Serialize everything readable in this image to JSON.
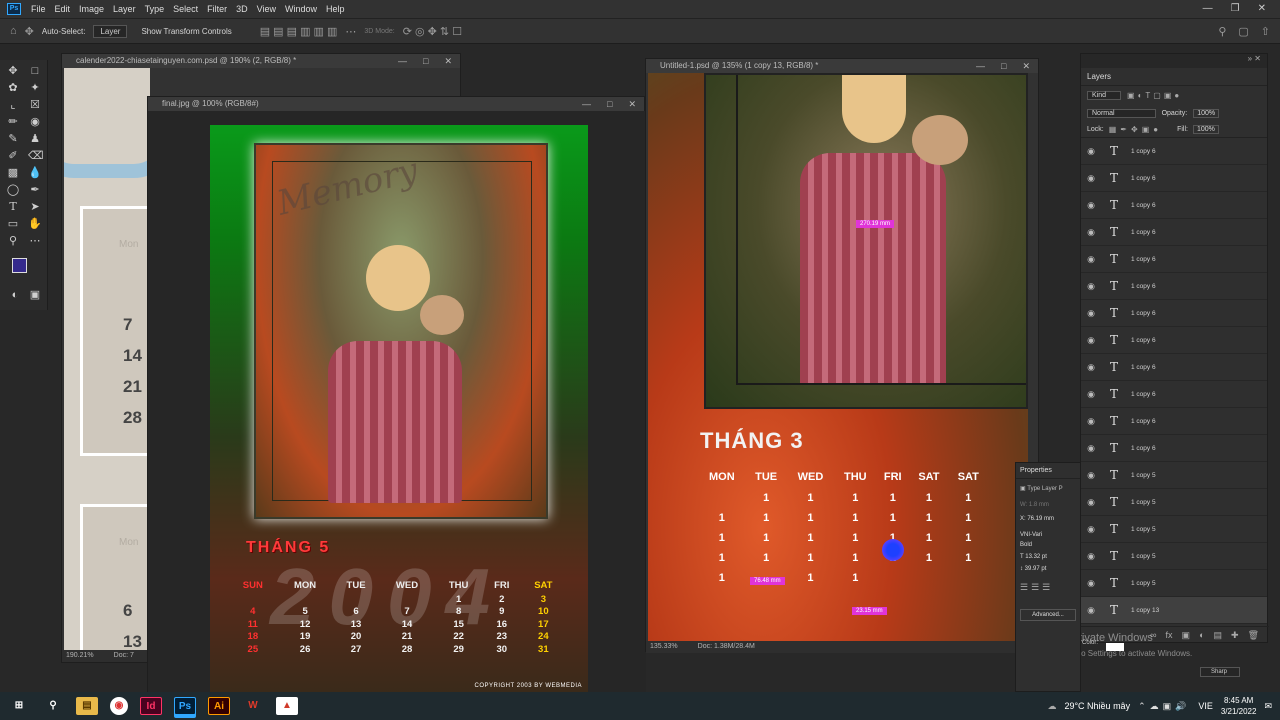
{
  "menu": {
    "items": [
      "File",
      "Edit",
      "Image",
      "Layer",
      "Type",
      "Select",
      "Filter",
      "3D",
      "View",
      "Window",
      "Help"
    ],
    "logo": "Ps"
  },
  "options": {
    "auto_select_label": "Auto-Select:",
    "auto_select_value": "Layer",
    "transform_label": "Show Transform Controls",
    "mode3d": "3D Mode:"
  },
  "doc1": {
    "title": "calender2022-chiasetainguyen.com.psd @ 190% (2, RGB/8) *",
    "zoom": "190.21%",
    "doc_label": "Doc: 7",
    "mon_label": "Mon",
    "numbers": [
      "7",
      "14",
      "21",
      "28"
    ],
    "numbers2": [
      "6",
      "13"
    ]
  },
  "doc2": {
    "title": "final.jpg @ 100% (RGB/8#)",
    "memory": "Memory",
    "month": "THÁNG 5",
    "year": "2004",
    "days": [
      "SUN",
      "MON",
      "TUE",
      "WED",
      "THU",
      "FRI",
      "SAT"
    ],
    "rows": [
      [
        "",
        "",
        "",
        "",
        "1",
        "2",
        "3"
      ],
      [
        "4",
        "5",
        "6",
        "7",
        "8",
        "9",
        "10"
      ],
      [
        "11",
        "12",
        "13",
        "14",
        "15",
        "16",
        "17"
      ],
      [
        "18",
        "19",
        "20",
        "21",
        "22",
        "23",
        "24"
      ],
      [
        "25",
        "26",
        "27",
        "28",
        "29",
        "30",
        "31"
      ]
    ],
    "copyright": "COPYRIGHT 2003 BY WEBMEDIA"
  },
  "doc3": {
    "title": "Untitled-1.psd @ 135% (1 copy 13, RGB/8) *",
    "month": "THÁNG 3",
    "days": [
      "MON",
      "TUE",
      "WED",
      "THU",
      "FRI",
      "SAT",
      "SAT"
    ],
    "rows": [
      [
        "",
        "1",
        "1",
        "1",
        "1",
        "1",
        "1"
      ],
      [
        "1",
        "1",
        "1",
        "1",
        "1",
        "1",
        "1"
      ],
      [
        "1",
        "1",
        "1",
        "1",
        "1",
        "1",
        "1"
      ],
      [
        "1",
        "1",
        "1",
        "1",
        "1",
        "1",
        "1"
      ],
      [
        "1",
        "",
        "1",
        "1",
        "",
        "",
        ""
      ]
    ],
    "measure1": "270.19 mm",
    "measure2": "76.48 mm",
    "measure3": "23.15 mm",
    "zoom": "135.33%",
    "doc_label": "Doc: 1.38M/28.4M"
  },
  "layers": {
    "title": "Layers",
    "kind": "Kind",
    "blend": "Normal",
    "opacity_label": "Opacity:",
    "opacity": "100%",
    "lock_label": "Lock:",
    "fill_label": "Fill:",
    "fill": "100%",
    "items": [
      "1 copy 6",
      "1 copy 6",
      "1 copy 6",
      "1 copy 6",
      "1 copy 6",
      "1 copy 6",
      "1 copy 6",
      "1 copy 6",
      "1 copy 6",
      "1 copy 6",
      "1 copy 6",
      "1 copy 6",
      "1 copy 5",
      "1 copy 5",
      "1 copy 5",
      "1 copy 5",
      "1 copy 5",
      "1 copy 13"
    ]
  },
  "properties": {
    "title": "Properties",
    "type_label": "Type Layer P",
    "w_label": "W:",
    "w_value": "1.8 mm",
    "x_label": "X:",
    "x_value": "76.19 mm",
    "font": "VNI-Vari",
    "style": "Bold",
    "size": "13.32 pt",
    "leading": "39.97 pt",
    "color_label": "Color:",
    "antialias": "Sharp",
    "advanced": "Advanced..."
  },
  "activate": {
    "line1": "Activate Windows",
    "line2": "Go to Settings to activate Windows."
  },
  "taskbar": {
    "weather": "29°C  Nhiều mây",
    "lang": "VIE",
    "time": "8:45 AM",
    "date": "3/21/2022"
  },
  "colors": {
    "accent": "#31a8ff",
    "green_bg": "#1a8a1a",
    "magenta": "#e034d8"
  }
}
